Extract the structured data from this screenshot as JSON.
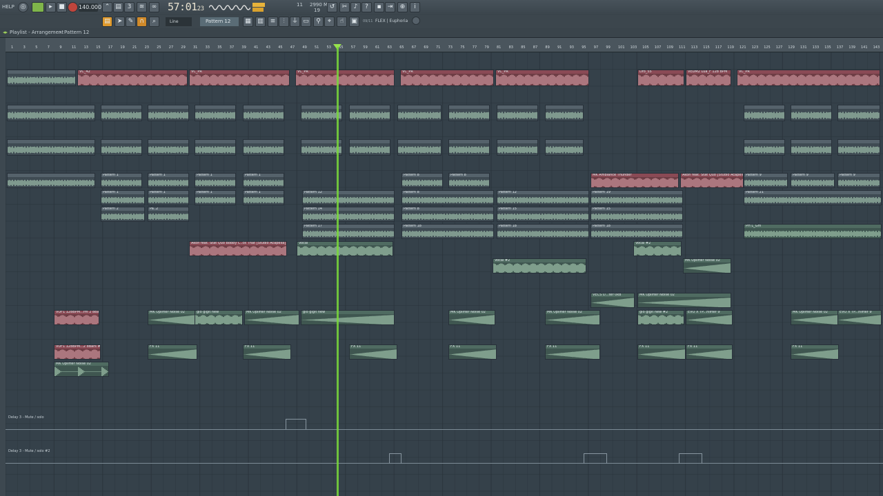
{
  "toolbar": {
    "help_label": "HELP",
    "tempo": "140.000",
    "time_display": "57:01",
    "time_sub": "23",
    "cpu_label": "11",
    "mem_label": "2990 MB",
    "voices_label": "19",
    "snap_label": "Line",
    "pattern_label": "Pattern 12",
    "plugin_label": "FLEX | Euphoria",
    "plugin_counter": "09/11"
  },
  "window": {
    "title": "Playlist - Arrangement",
    "breadcrumb": "Pattern 12"
  },
  "ruler": {
    "numbers": [
      "1",
      "3",
      "5",
      "7",
      "9",
      "11",
      "13",
      "15",
      "17",
      "19",
      "21",
      "23",
      "25",
      "27",
      "29",
      "31",
      "33",
      "35",
      "37",
      "39",
      "41",
      "43",
      "45",
      "47",
      "49",
      "51",
      "53",
      "55",
      "57",
      "59",
      "61",
      "63",
      "65",
      "67",
      "69",
      "71",
      "73",
      "75",
      "77",
      "79",
      "81",
      "83",
      "85",
      "87",
      "89",
      "91",
      "93",
      "95",
      "97",
      "99",
      "101",
      "103",
      "105",
      "107",
      "109",
      "111",
      "113",
      "115",
      "117",
      "119",
      "121",
      "123",
      "125",
      "127",
      "129",
      "131",
      "133",
      "135",
      "137",
      "139",
      "141",
      "143"
    ]
  },
  "clip_labels": {
    "vc": "VC_PR",
    "vcl": "VC_42",
    "drop": "Dro_55",
    "vedm": "VEDM2 Lua_F 128 BPM",
    "p1": "Pattern 1",
    "p2": "Pattern 2",
    "p8": "Pattern 8",
    "p12": "Pattern 12",
    "p14": "Pattern 14",
    "p15": "Pattern 15",
    "p17": "Pattern 17",
    "p18": "Pattern 18",
    "p19": "Pattern 19",
    "p20": "Pattern 20",
    "p11": "Pattern 11",
    "p21": "Pattern 21",
    "p9": "Pattern 9",
    "pa1": "Pa..1",
    "pa2": "Pa..2",
    "ambience": "MK Ambiance Thunder",
    "akon1": "Akon feat. Stat Quo [Studio Acapella]",
    "akon2": "Akon feat. Stat Quo Bobby C..ck That [Studio Acapella]",
    "vocal": "Vocal",
    "vocal2": "Vocal #2",
    "uplifter": "MK Uplifter Noise 02",
    "gio": "gio gigit new",
    "gio2": "gio gigit new #2",
    "vuf": "VUF1 128BPM...rm 2 8Bars",
    "vuf2": "VUF1 128BPM...2 8Bars #2",
    "fx11": "FX 11",
    "evo": "EVO X TP...nlifter 9",
    "evo2": "EVO X TP...nlifter 9",
    "vecs": "VECS D...ter 0k8",
    "phl": "PH L_Gm",
    "delay1": "Delay 3 - Mute / solo",
    "delay2": "Delay 3 - Mute / solo #2"
  },
  "colors": {
    "lane_bg": "#35414a",
    "clip_pink": "#b65a66",
    "clip_green": "#7fbf95",
    "clip_gray": "#4d5a63",
    "playhead": "#79d93a",
    "accent_orange": "#e0a030"
  }
}
